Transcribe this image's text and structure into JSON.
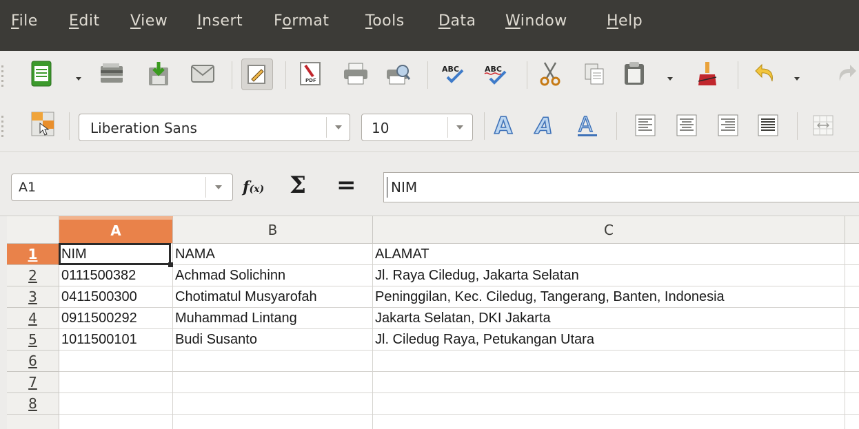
{
  "menu": {
    "items": [
      {
        "pre": "",
        "u": "F",
        "post": "ile"
      },
      {
        "pre": "",
        "u": "E",
        "post": "dit"
      },
      {
        "pre": "",
        "u": "V",
        "post": "iew"
      },
      {
        "pre": "",
        "u": "I",
        "post": "nsert"
      },
      {
        "pre": "F",
        "u": "o",
        "post": "rmat"
      },
      {
        "pre": "",
        "u": "T",
        "post": "ools"
      },
      {
        "pre": "",
        "u": "D",
        "post": "ata"
      },
      {
        "pre": "",
        "u": "W",
        "post": "indow"
      },
      {
        "pre": "",
        "u": "H",
        "post": "elp"
      }
    ]
  },
  "toolbar": {
    "font_name": "Liberation Sans",
    "font_size": "10"
  },
  "formula": {
    "name_box": "A1",
    "fx_label": "f",
    "fx_sub": "(x)",
    "sigma": "Σ",
    "equals": "=",
    "content": "NIM"
  },
  "sheet": {
    "columns": [
      "A",
      "B",
      "C"
    ],
    "selected_column": "A",
    "rows": [
      "1",
      "2",
      "3",
      "4",
      "5",
      "6",
      "7",
      "8"
    ],
    "selected_row": "1",
    "cells": [
      [
        "NIM",
        "NAMA",
        "ALAMAT"
      ],
      [
        "0111500382",
        "Achmad Solichinn",
        "Jl. Raya Ciledug, Jakarta Selatan"
      ],
      [
        "0411500300",
        "Chotimatul Musyarofah",
        "Peninggilan, Kec. Ciledug, Tangerang, Banten, Indonesia"
      ],
      [
        "0911500292",
        "Muhammad Lintang",
        "Jakarta Selatan, DKI Jakarta"
      ],
      [
        "1011500101",
        "Budi Susanto",
        "Jl. Ciledug Raya, Petukangan Utara"
      ],
      [
        "",
        "",
        ""
      ],
      [
        "",
        "",
        ""
      ],
      [
        "",
        "",
        ""
      ]
    ],
    "active_cell": "A1"
  },
  "colors": {
    "menubar": "#3c3b37",
    "selection_header": "#e9824a",
    "toolbar_bg": "#edecea"
  }
}
